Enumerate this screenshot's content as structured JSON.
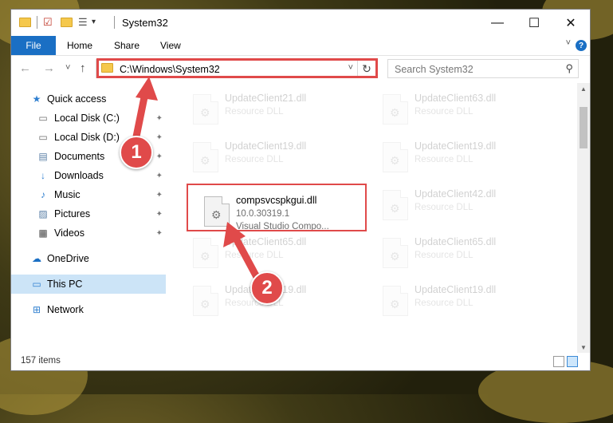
{
  "window": {
    "title": "System32",
    "min_glyph": "—",
    "max_glyph": "☐",
    "close_glyph": "✕"
  },
  "ribbon": {
    "tabs": [
      {
        "label": "File"
      },
      {
        "label": "Home"
      },
      {
        "label": "Share"
      },
      {
        "label": "View"
      }
    ],
    "help_glyph": "?",
    "collapse_glyph": "˅"
  },
  "nav": {
    "back_glyph": "←",
    "forward_glyph": "→",
    "recent_glyph": "˅",
    "up_glyph": "↑",
    "address_path": "C:\\Windows\\System32",
    "address_dropdown_glyph": "˅",
    "refresh_glyph": "↻",
    "search_placeholder": "Search System32",
    "search_glyph": "⚲"
  },
  "sidebar": {
    "items": [
      {
        "label": "Quick access",
        "icon": "star-icon",
        "glyph": "★",
        "color": "#2f7fd0",
        "pinned": false
      },
      {
        "label": "Local Disk (C:)",
        "icon": "drive-icon",
        "glyph": "▭",
        "color": "#6b6b6b",
        "pinned": true
      },
      {
        "label": "Local Disk (D:)",
        "icon": "drive-icon",
        "glyph": "▭",
        "color": "#6b6b6b",
        "pinned": true
      },
      {
        "label": "Documents",
        "icon": "documents-icon",
        "glyph": "▤",
        "color": "#5a7fa6",
        "pinned": true
      },
      {
        "label": "Downloads",
        "icon": "downloads-icon",
        "glyph": "↓",
        "color": "#2f7fd0",
        "pinned": true
      },
      {
        "label": "Music",
        "icon": "music-icon",
        "glyph": "♪",
        "color": "#2f7fd0",
        "pinned": true
      },
      {
        "label": "Pictures",
        "icon": "pictures-icon",
        "glyph": "▨",
        "color": "#5a7fa6",
        "pinned": true
      },
      {
        "label": "Videos",
        "icon": "videos-icon",
        "glyph": "▦",
        "color": "#444444",
        "pinned": true
      },
      {
        "label": "OneDrive",
        "icon": "cloud-icon",
        "glyph": "☁",
        "color": "#1a6fc4",
        "pinned": false
      },
      {
        "label": "This PC",
        "icon": "computer-icon",
        "glyph": "▭",
        "color": "#2f7fd0",
        "pinned": false
      },
      {
        "label": "Network",
        "icon": "network-icon",
        "glyph": "⊞",
        "color": "#2f7fd0",
        "pinned": false
      }
    ],
    "pin_glyph": "✦"
  },
  "files": [
    {
      "name": "UpdateClient21.dll",
      "sub": "Resource DLL"
    },
    {
      "name": "UpdateClient63.dll",
      "sub": "Resource DLL"
    },
    {
      "name": "UpdateClient19.dll",
      "sub": "Resource DLL"
    },
    {
      "name": "UpdateClient19.dll",
      "sub": "Resource DLL"
    },
    {
      "name": "compsvcspkgui.dll",
      "sub": "10.0.30319.1",
      "sub2": "Visual Studio Compo..."
    },
    {
      "name": "UpdateClient42.dll",
      "sub": "Resource DLL"
    },
    {
      "name": "UpdateClient65.dll",
      "sub": "Resource DLL"
    },
    {
      "name": "UpdateClient65.dll",
      "sub": "Resource DLL"
    },
    {
      "name": "UpdateClient19.dll",
      "sub": "Resource DLL"
    },
    {
      "name": "UpdateClient19.dll",
      "sub": "Resource DLL"
    }
  ],
  "status": {
    "item_count": "157 items"
  },
  "callouts": {
    "step1": "1",
    "step2": "2",
    "color": "#e04a4a"
  },
  "scrollbar": {
    "up_glyph": "▲",
    "down_glyph": "▼"
  }
}
